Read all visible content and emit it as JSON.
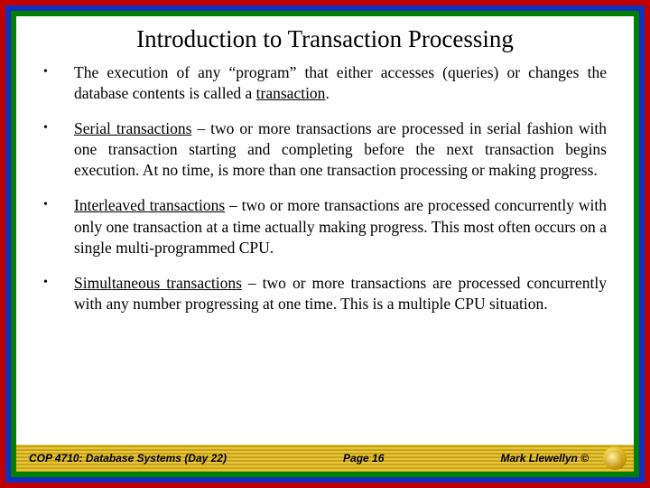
{
  "title": "Introduction to Transaction Processing",
  "bullets": [
    {
      "html": "The execution of any “program” that either accesses (queries) or changes the database contents is called a <span class=\"underline\">transaction</span>."
    },
    {
      "html": "<span class=\"underline\">Serial transactions</span> – two or more transactions are processed in serial fashion with one transaction starting and completing before the next transaction begins execution.  At no time, is more than one transaction processing or making progress."
    },
    {
      "html": "<span class=\"underline\">Interleaved transactions</span> – two or more transactions are processed concurrently with only one transaction at a time actually making progress.  This most often occurs on a single multi-programmed CPU."
    },
    {
      "html": "<span class=\"underline\">Simultaneous transactions</span> – two or more transactions are processed concurrently with any number progressing at one time.  This is a multiple CPU situation."
    }
  ],
  "footer": {
    "left": "COP 4710: Database Systems  (Day 22)",
    "center": "Page 16",
    "right": "Mark Llewellyn ©"
  }
}
